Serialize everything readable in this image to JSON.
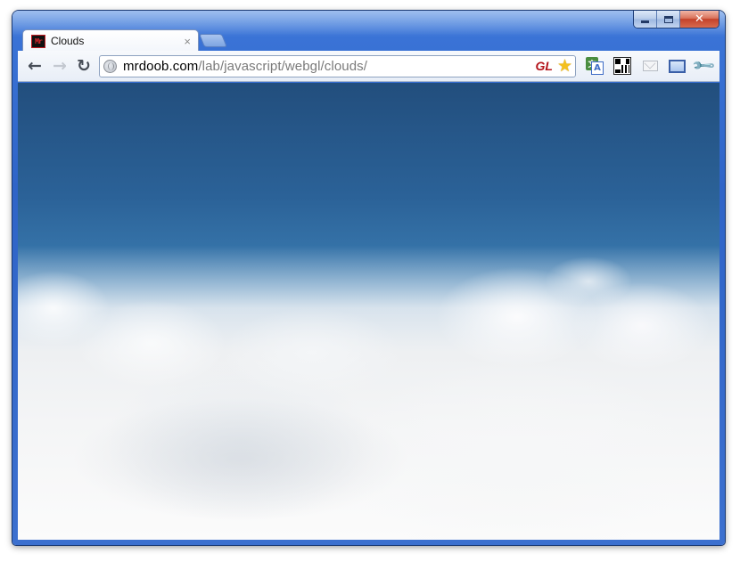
{
  "window": {
    "controls": {
      "minimize": "minimize",
      "maximize": "maximize",
      "close": "✕"
    }
  },
  "tabs": [
    {
      "title": "Clouds",
      "favicon_text": "Mr",
      "close_glyph": "×",
      "active": true
    }
  ],
  "toolbar": {
    "back_glyph": "←",
    "forward_glyph": "→",
    "reload_glyph": "↻",
    "url_host": "mrdoob.com",
    "url_path": "/lab/javascript/webgl/clouds/",
    "page_action_badge": "GL",
    "bookmark_glyph": "★",
    "extensions": [
      "translate-icon",
      "qr-code-icon",
      "mail-icon",
      "fullscreen-icon"
    ],
    "translate_back": "文",
    "translate_front": "A",
    "wrench_glyph": "🔧"
  },
  "colors": {
    "sky_top": "#224e7d",
    "sky_bottom": "#7aaed3",
    "cloud": "#f4f5f6",
    "gl_badge": "#b3141b",
    "star": "#f4c01d",
    "frame": "#3a73d6"
  }
}
